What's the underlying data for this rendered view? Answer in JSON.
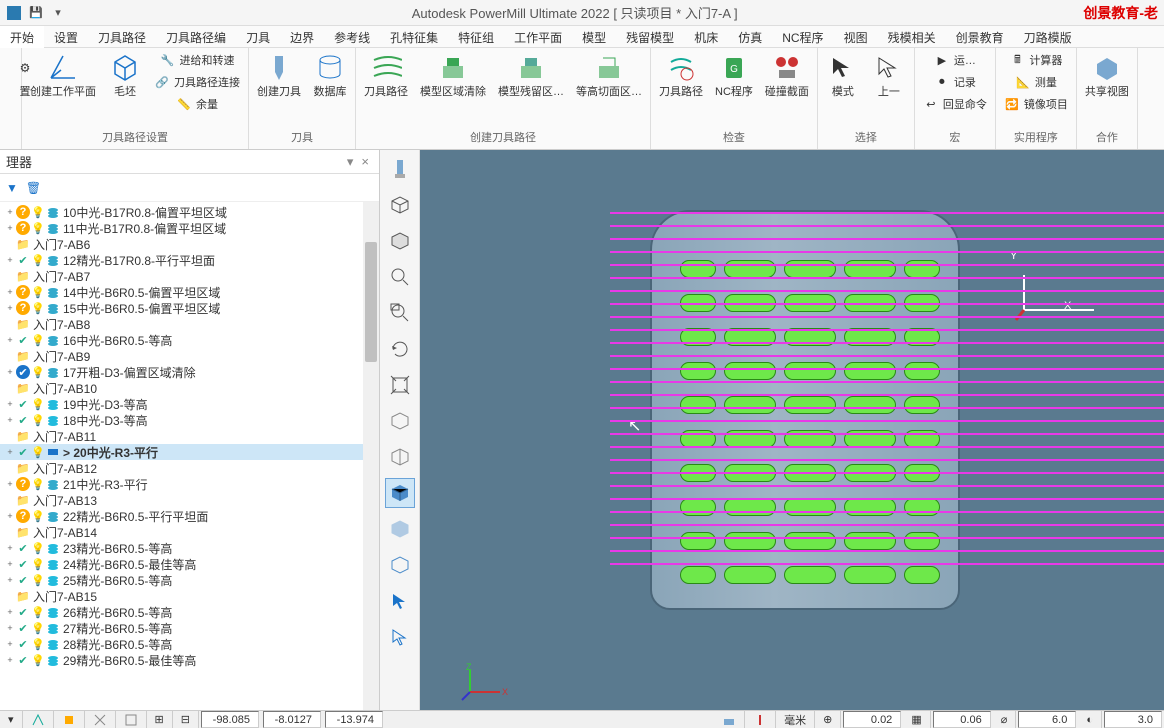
{
  "title": "Autodesk PowerMill Ultimate 2022    [ 只读项目 * 入门7-A ]",
  "brand": "创景教育-老",
  "menu": [
    "开始",
    "设置",
    "刀具路径",
    "刀具路径编",
    "刀具",
    "边界",
    "参考线",
    "孔特征集",
    "特征组",
    "工作平面",
    "模型",
    "残留模型",
    "机床",
    "仿真",
    "NC程序",
    "视图",
    "残模相关",
    "创景教育",
    "刀路模版"
  ],
  "ribbon": {
    "g1_items": [
      "创建工作平面",
      "毛坯"
    ],
    "g1_sub": [
      "进给和转速",
      "刀具路径连接",
      "余量"
    ],
    "g1_label": "刀具路径设置",
    "g2_items": [
      "创建刀具",
      "数据库"
    ],
    "g2_label": "刀具",
    "g3_main": "刀具路径",
    "g3_items": [
      "模型区域清除",
      "模型残留区…",
      "等高切面区…"
    ],
    "g3_label": "创建刀具路径",
    "g4_items": [
      "刀具路径",
      "NC程序",
      "碰撞截面"
    ],
    "g4_label": "检查",
    "g5_items": [
      "模式",
      "上一"
    ],
    "g5_label": "选择",
    "g6_items": [
      "运…",
      "记录",
      "回显命令"
    ],
    "g6_label": "宏",
    "g7_items": [
      "计算器",
      "测量",
      "镜像项目"
    ],
    "g7_label": "实用程序",
    "g8": "共享视图",
    "g8_label": "合作"
  },
  "explorer": {
    "title": "理器",
    "items": [
      {
        "tgl": "+",
        "icons": [
          "q",
          "bulb",
          "stack"
        ],
        "txt": "10中光-B17R0.8-偏置平坦区域"
      },
      {
        "tgl": "+",
        "icons": [
          "q",
          "bulb",
          "stack"
        ],
        "txt": "11中光-B17R0.8-偏置平坦区域"
      },
      {
        "tgl": "",
        "icons": [
          "fold"
        ],
        "txt": "入门7-AB6"
      },
      {
        "tgl": "+",
        "icons": [
          "chk",
          "bulb",
          "stack"
        ],
        "txt": "12精光-B17R0.8-平行平坦面"
      },
      {
        "tgl": "",
        "icons": [
          "fold"
        ],
        "txt": "入门7-AB7"
      },
      {
        "tgl": "+",
        "icons": [
          "q",
          "bulb",
          "stack"
        ],
        "txt": "14中光-B6R0.5-偏置平坦区域"
      },
      {
        "tgl": "+",
        "icons": [
          "q",
          "bulb",
          "stack"
        ],
        "txt": "15中光-B6R0.5-偏置平坦区域"
      },
      {
        "tgl": "",
        "icons": [
          "fold"
        ],
        "txt": "入门7-AB8"
      },
      {
        "tgl": "+",
        "icons": [
          "chk",
          "bulb",
          "stack"
        ],
        "txt": "16中光-B6R0.5-等高"
      },
      {
        "tgl": "",
        "icons": [
          "fold"
        ],
        "txt": "入门7-AB9"
      },
      {
        "tgl": "+",
        "icons": [
          "chkb",
          "bulb",
          "stack"
        ],
        "txt": "17开粗-D3-偏置区域清除"
      },
      {
        "tgl": "",
        "icons": [
          "fold"
        ],
        "txt": "入门7-AB10"
      },
      {
        "tgl": "+",
        "icons": [
          "chk",
          "bulb",
          "stack2"
        ],
        "txt": "19中光-D3-等高"
      },
      {
        "tgl": "+",
        "icons": [
          "chk",
          "bulb",
          "stack2"
        ],
        "txt": "18中光-D3-等高"
      },
      {
        "tgl": "",
        "icons": [
          "fold"
        ],
        "txt": "入门7-AB11"
      },
      {
        "tgl": "+",
        "icons": [
          "chk",
          "bulbo",
          "line"
        ],
        "txt": "> 20中光-R3-平行",
        "bold": true,
        "sel": true
      },
      {
        "tgl": "",
        "icons": [
          "fold"
        ],
        "txt": "入门7-AB12"
      },
      {
        "tgl": "+",
        "icons": [
          "q",
          "bulb",
          "stack"
        ],
        "txt": "21中光-R3-平行"
      },
      {
        "tgl": "",
        "icons": [
          "fold"
        ],
        "txt": "入门7-AB13"
      },
      {
        "tgl": "+",
        "icons": [
          "q",
          "bulb",
          "stack"
        ],
        "txt": "22精光-B6R0.5-平行平坦面"
      },
      {
        "tgl": "",
        "icons": [
          "fold"
        ],
        "txt": "入门7-AB14"
      },
      {
        "tgl": "+",
        "icons": [
          "chk",
          "bulb",
          "stack2"
        ],
        "txt": "23精光-B6R0.5-等高"
      },
      {
        "tgl": "+",
        "icons": [
          "chk",
          "bulb",
          "stack2"
        ],
        "txt": "24精光-B6R0.5-最佳等高"
      },
      {
        "tgl": "+",
        "icons": [
          "chk",
          "bulb",
          "stack2"
        ],
        "txt": "25精光-B6R0.5-等高"
      },
      {
        "tgl": "",
        "icons": [
          "fold"
        ],
        "txt": "入门7-AB15"
      },
      {
        "tgl": "+",
        "icons": [
          "chk",
          "bulb",
          "stack2"
        ],
        "txt": "26精光-B6R0.5-等高"
      },
      {
        "tgl": "+",
        "icons": [
          "chk",
          "bulb",
          "stack2"
        ],
        "txt": "27精光-B6R0.5-等高"
      },
      {
        "tgl": "+",
        "icons": [
          "chk",
          "bulb",
          "stack2"
        ],
        "txt": "28精光-B6R0.5-等高"
      },
      {
        "tgl": "+",
        "icons": [
          "chk",
          "bulb",
          "stack2"
        ],
        "txt": "29精光-B6R0.5-最佳等高"
      }
    ]
  },
  "axis": {
    "y": "Y",
    "x": "X"
  },
  "status": {
    "x": "-98.085",
    "y": "-8.0127",
    "z": "-13.974",
    "unit": "毫米",
    "tol": "0.02",
    "step": "0.06",
    "diam": "6.0",
    "rad": "3.0"
  }
}
